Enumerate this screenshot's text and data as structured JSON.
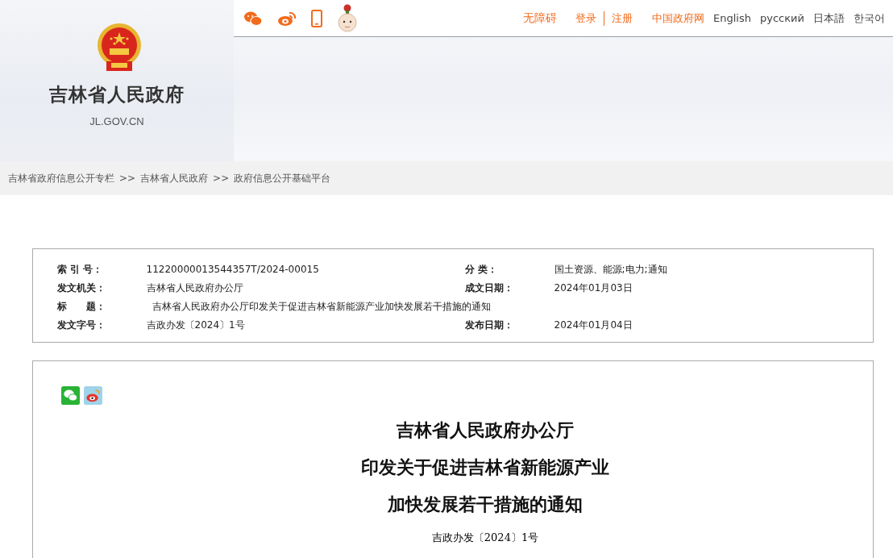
{
  "header": {
    "site_name": "吉林省人民政府",
    "domain": "JL.GOV.CN"
  },
  "top_links": [
    {
      "label": "无障碍",
      "kind": "accent"
    },
    {
      "label": "登录",
      "kind": "accent"
    },
    {
      "label": "注册",
      "kind": "accent"
    },
    {
      "label": "中国政府网",
      "kind": "accent"
    },
    {
      "label": "English",
      "kind": "plain"
    },
    {
      "label": "русский",
      "kind": "plain"
    },
    {
      "label": "日本語",
      "kind": "plain"
    },
    {
      "label": "한국어",
      "kind": "plain"
    }
  ],
  "breadcrumb": {
    "items": [
      "吉林省政府信息公开专栏",
      "吉林省人民政府",
      "政府信息公开基础平台"
    ],
    "separator": ">>"
  },
  "meta": [
    {
      "label": "索 引 号：",
      "value": "11220000013544357T/2024-00015"
    },
    {
      "label": "分 类：",
      "value": "国土资源、能源;电力;通知"
    },
    {
      "label": "发文机关：",
      "value": "吉林省人民政府办公厅"
    },
    {
      "label": "成文日期：",
      "value": "2024年01月03日"
    },
    {
      "label": "标　　题：",
      "value": "吉林省人民政府办公厅印发关于促进吉林省新能源产业加快发展若干措施的通知"
    },
    {
      "label": "发文字号：",
      "value": "吉政办发〔2024〕1号"
    },
    {
      "label": "发布日期：",
      "value": "2024年01月04日"
    }
  ],
  "article": {
    "title_lines": [
      "吉林省人民政府办公厅",
      "印发关于促进吉林省新能源产业",
      "加快发展若干措施的通知"
    ],
    "doc_number": "吉政办发〔2024〕1号"
  }
}
